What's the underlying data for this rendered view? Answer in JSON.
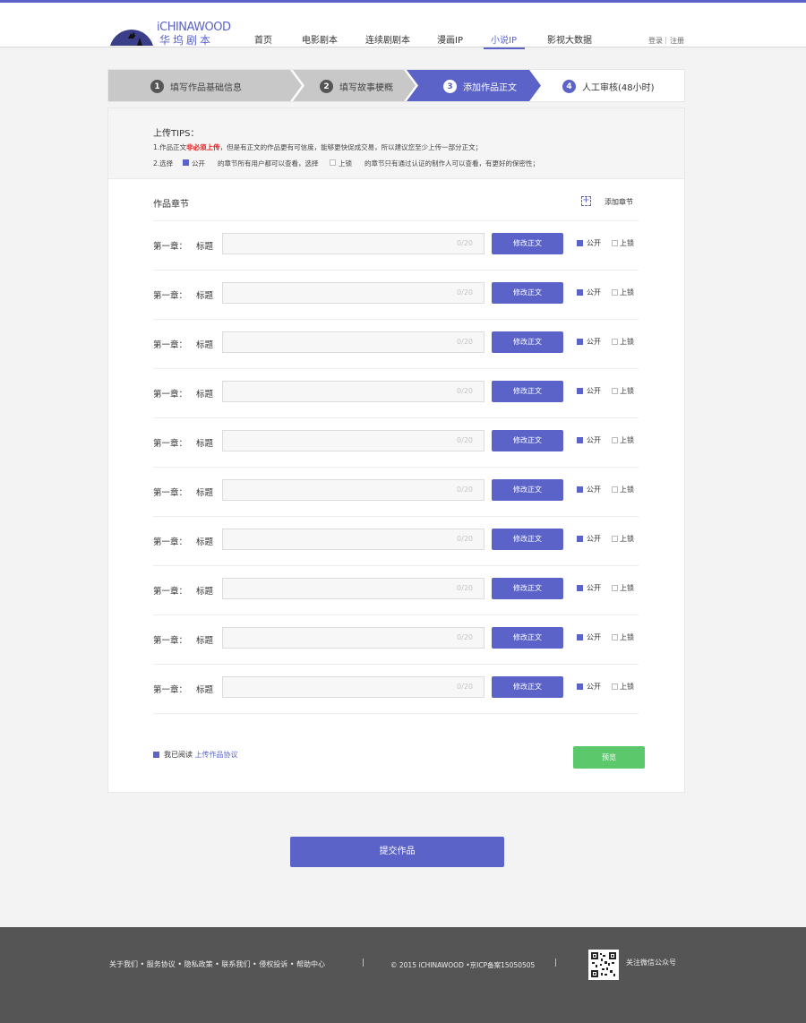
{
  "brand": {
    "name_en": "iCHINAWOOD",
    "name_cn": "华坞剧本"
  },
  "nav": {
    "items": [
      "首页",
      "电影剧本",
      "连续剧剧本",
      "漫画IP",
      "小说IP",
      "影视大数据"
    ],
    "active_index": 4
  },
  "auth": {
    "login": "登录",
    "separator": "|",
    "register": "注册"
  },
  "steps": [
    {
      "num": "1",
      "label": "填写作品基础信息",
      "state": "done"
    },
    {
      "num": "2",
      "label": "填写故事梗概",
      "state": "done"
    },
    {
      "num": "3",
      "label": "添加作品正文",
      "state": "current"
    },
    {
      "num": "4",
      "label": "人工审核(48小时)",
      "state": "todo"
    }
  ],
  "tips": {
    "title": "上传TIPS：",
    "line1_a": "1.作品正文",
    "line1_red": "非必须上传",
    "line1_b": "，但是有正文的作品更有可信度，能够更快促成交易，所以建议您至少上传一部分正文；",
    "line2_a": "2.选择",
    "public": "公开",
    "line2_b": "的章节所有用户都可以查看，选择",
    "lock": "上锁",
    "line2_c": "的章节只有通过认证的制作人可以查看，有更好的保密性；"
  },
  "chapters": {
    "title": "作品章节",
    "add_label": "添加章节",
    "rows": [
      {
        "chapter": "第一章：",
        "title_label": "标题",
        "value": "",
        "counter": "0/20",
        "edit_label": "修改正文",
        "public_label": "公开",
        "lock_label": "上锁"
      },
      {
        "chapter": "第一章：",
        "title_label": "标题",
        "value": "",
        "counter": "0/20",
        "edit_label": "修改正文",
        "public_label": "公开",
        "lock_label": "上锁"
      },
      {
        "chapter": "第一章：",
        "title_label": "标题",
        "value": "",
        "counter": "0/20",
        "edit_label": "修改正文",
        "public_label": "公开",
        "lock_label": "上锁"
      },
      {
        "chapter": "第一章：",
        "title_label": "标题",
        "value": "",
        "counter": "0/20",
        "edit_label": "修改正文",
        "public_label": "公开",
        "lock_label": "上锁"
      },
      {
        "chapter": "第一章：",
        "title_label": "标题",
        "value": "",
        "counter": "0/20",
        "edit_label": "修改正文",
        "public_label": "公开",
        "lock_label": "上锁"
      },
      {
        "chapter": "第一章：",
        "title_label": "标题",
        "value": "",
        "counter": "0/20",
        "edit_label": "修改正文",
        "public_label": "公开",
        "lock_label": "上锁"
      },
      {
        "chapter": "第一章：",
        "title_label": "标题",
        "value": "",
        "counter": "0/20",
        "edit_label": "修改正文",
        "public_label": "公开",
        "lock_label": "上锁"
      },
      {
        "chapter": "第一章：",
        "title_label": "标题",
        "value": "",
        "counter": "0/20",
        "edit_label": "修改正文",
        "public_label": "公开",
        "lock_label": "上锁"
      },
      {
        "chapter": "第一章：",
        "title_label": "标题",
        "value": "",
        "counter": "0/20",
        "edit_label": "修改正文",
        "public_label": "公开",
        "lock_label": "上锁"
      },
      {
        "chapter": "第一章：",
        "title_label": "标题",
        "value": "",
        "counter": "0/20",
        "edit_label": "修改正文",
        "public_label": "公开",
        "lock_label": "上锁"
      }
    ]
  },
  "agreement": {
    "prefix": "我已阅读",
    "link": "上传作品协议"
  },
  "preview_label": "预览",
  "submit_label": "提交作品",
  "footer": {
    "links": "关于我们 • 服务协议 • 隐私政策 • 联系我们 • 侵权投诉 • 帮助中心",
    "separator": "|",
    "copyright": "© 2015 iCHINAWOOD •京ICP备案15050505",
    "wechat": "关注微信公众号"
  },
  "colors": {
    "accent": "#5b63c8",
    "success": "#5bc86b",
    "danger": "#e02020",
    "footer_bg": "#555555"
  }
}
